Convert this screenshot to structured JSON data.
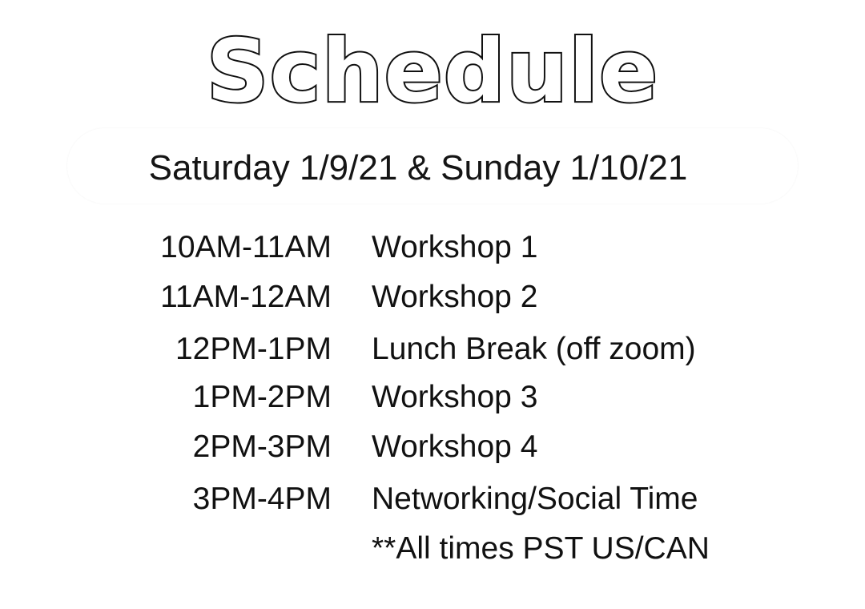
{
  "title": "Schedule",
  "dates": "Saturday 1/9/21 & Sunday 1/10/21",
  "rows": [
    {
      "time": "10AM-11AM",
      "event": "Workshop 1"
    },
    {
      "time": "11AM-12AM",
      "event": "Workshop 2"
    },
    {
      "time": "12PM-1PM",
      "event": "Lunch Break (off zoom)"
    },
    {
      "time": "1PM-2PM",
      "event": "Workshop 3"
    },
    {
      "time": "2PM-3PM",
      "event": "Workshop 4"
    },
    {
      "time": "3PM-4PM",
      "event": "Networking/Social Time"
    }
  ],
  "note": "**All times PST US/CAN",
  "colors": {
    "text": "#111111",
    "background": "#ffffff",
    "title_outline": "#111111"
  }
}
